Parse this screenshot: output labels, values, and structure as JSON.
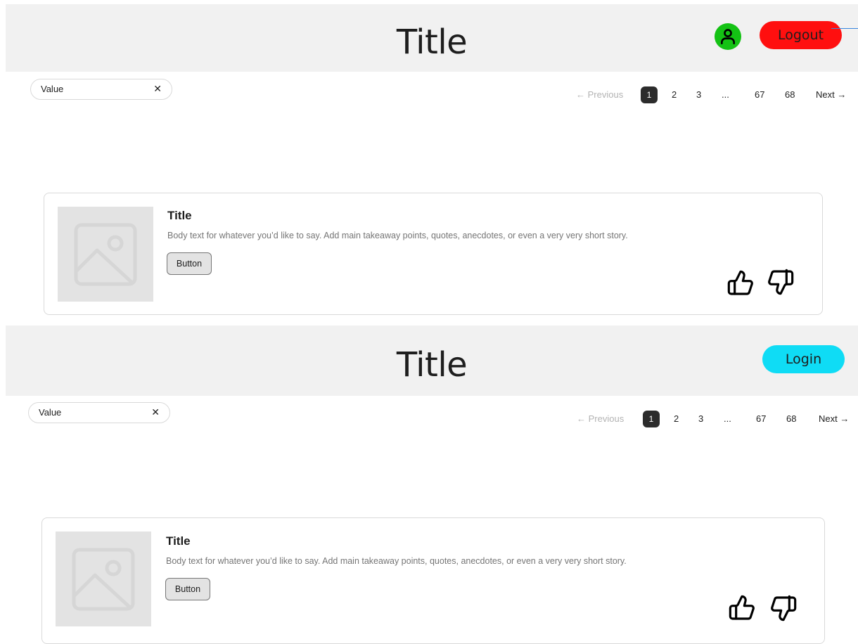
{
  "top": {
    "header": {
      "title": "Title",
      "logout_label": "Logout"
    },
    "search": {
      "value": "Value",
      "clear_glyph": "✕"
    },
    "pagination": {
      "previous_label": "← Previous",
      "current_page": "1",
      "pages": [
        "2",
        "3",
        "...",
        "67",
        "68"
      ],
      "next_label": "Next →"
    },
    "card": {
      "title": "Title",
      "body": "Body text for whatever you’d like to say. Add main takeaway points, quotes, anecdotes, or even a very very short story.",
      "button_label": "Button"
    }
  },
  "bottom": {
    "header": {
      "title": "Title",
      "login_label": "Login"
    },
    "search": {
      "value": "Value",
      "clear_glyph": "✕"
    },
    "pagination": {
      "previous_label": "← Previous",
      "current_page": "1",
      "pages": [
        "2",
        "3",
        "...",
        "67",
        "68"
      ],
      "next_label": "Next →"
    },
    "card": {
      "title": "Title",
      "body": "Body text for whatever you’d like to say. Add main takeaway points, quotes, anecdotes, or even a very very short story.",
      "button_label": "Button"
    }
  },
  "icons": {
    "avatar": "user-icon",
    "image_placeholder": "image-icon",
    "like": "thumbs-up-icon",
    "dislike": "thumbs-down-icon"
  },
  "colors": {
    "header_bg": "#f1f1f1",
    "avatar_bg": "#14c214",
    "logout_bg": "#ff0f0f",
    "login_bg": "#0fdcf5",
    "current_page_bg": "#2c2c2c",
    "image_placeholder_bg": "#e3e3e3"
  }
}
